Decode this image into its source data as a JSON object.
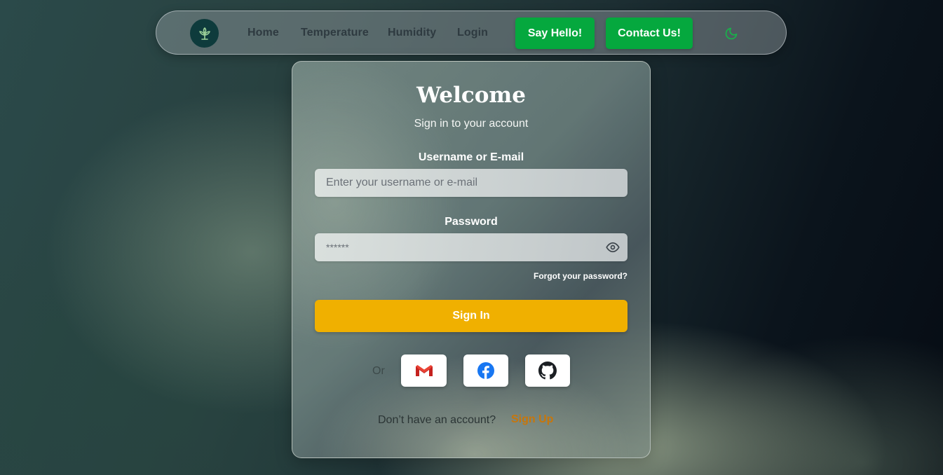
{
  "nav": {
    "links": [
      "Home",
      "Temperature",
      "Humidity",
      "Login"
    ],
    "say_hello": "Say Hello!",
    "contact": "Contact Us!"
  },
  "card": {
    "title": "Welcome",
    "subtitle": "Sign in to your account",
    "username_label": "Username or E-mail",
    "username_placeholder": "Enter your username or e-mail",
    "password_label": "Password",
    "password_placeholder": "******",
    "forgot": "Forgot your password?",
    "signin": "Sign In",
    "or": "Or",
    "no_account": "Don’t have an account?",
    "signup": "Sign Up"
  },
  "icons": [
    "leaf-logo-icon",
    "moon-icon",
    "eye-icon",
    "gmail-icon",
    "facebook-icon",
    "github-icon"
  ],
  "colors": {
    "accent_green": "#05a83e",
    "signin_yellow": "#f0b000",
    "signup_orange": "#c7760b",
    "logo_bg": "#0e3b3c"
  }
}
